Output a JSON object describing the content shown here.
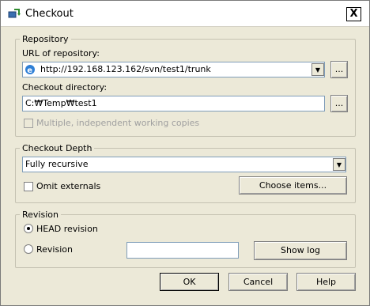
{
  "window": {
    "title": "Checkout",
    "close_symbol": "X"
  },
  "repository": {
    "group_label": "Repository",
    "url_label": "URL of repository:",
    "url_value": "http://192.168.123.162/svn/test1/trunk",
    "url_browse": "...",
    "dir_label": "Checkout directory:",
    "dir_value": "C:₩Temp₩test1",
    "dir_browse": "...",
    "multiple_label": "Multiple, independent working copies",
    "multiple_checked": false,
    "multiple_enabled": false
  },
  "depth": {
    "group_label": "Checkout Depth",
    "selected": "Fully recursive",
    "omit_externals_label": "Omit externals",
    "omit_externals_checked": false,
    "choose_items_label": "Choose items..."
  },
  "revision": {
    "group_label": "Revision",
    "head_label": "HEAD revision",
    "revision_label": "Revision",
    "revision_value": "",
    "selected": "HEAD revision",
    "show_log_label": "Show log"
  },
  "footer": {
    "ok_label": "OK",
    "cancel_label": "Cancel",
    "help_label": "Help"
  },
  "colors": {
    "dialog_bg": "#ece9d8",
    "field_border": "#7f9db9"
  },
  "icons": {
    "title": "tortoisesvn-checkout-icon",
    "url": "internet-explorer-icon"
  }
}
